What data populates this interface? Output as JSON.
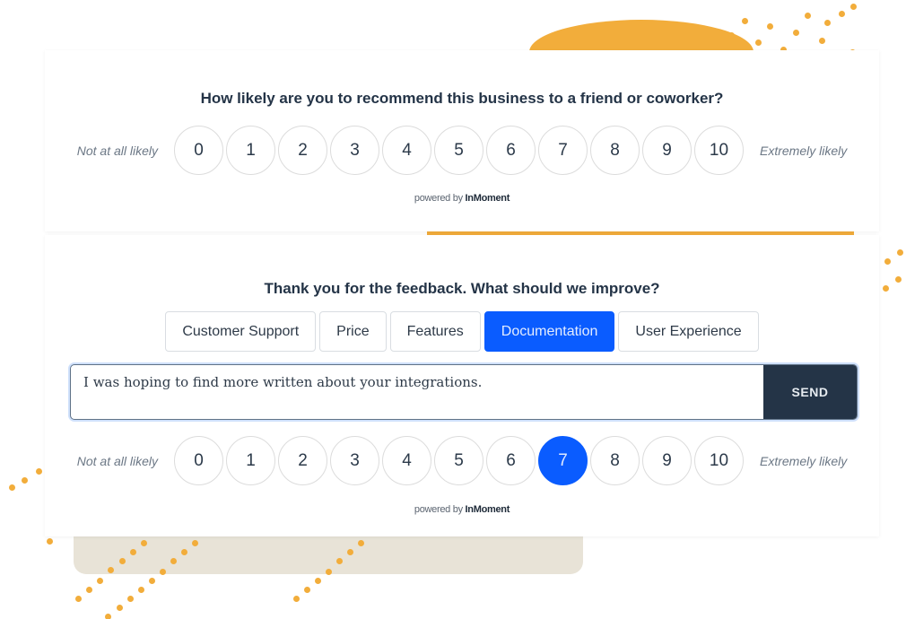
{
  "decor": {
    "accent_color": "#f2ad3b",
    "beige_color": "#e8e3d7"
  },
  "nps_card": {
    "question": "How likely are you to recommend this business to a friend or coworker?",
    "label_low": "Not at all likely",
    "label_high": "Extremely likely",
    "scale": [
      "0",
      "1",
      "2",
      "3",
      "4",
      "5",
      "6",
      "7",
      "8",
      "9",
      "10"
    ],
    "selected": null,
    "powered_prefix": "powered by",
    "powered_brand": "InMoment"
  },
  "followup_card": {
    "question": "Thank you for the feedback. What should we improve?",
    "options": [
      {
        "label": "Customer Support",
        "selected": false
      },
      {
        "label": "Price",
        "selected": false
      },
      {
        "label": "Features",
        "selected": false
      },
      {
        "label": "Documentation",
        "selected": true
      },
      {
        "label": "User Experience",
        "selected": false
      }
    ],
    "input_value": "I was hoping to find more written about your integrations.",
    "send_label": "SEND",
    "label_low": "Not at all likely",
    "label_high": "Extremely likely",
    "scale": [
      "0",
      "1",
      "2",
      "3",
      "4",
      "5",
      "6",
      "7",
      "8",
      "9",
      "10"
    ],
    "selected": "7",
    "selected_color": "#0a5cff",
    "powered_prefix": "powered by",
    "powered_brand": "InMoment"
  }
}
